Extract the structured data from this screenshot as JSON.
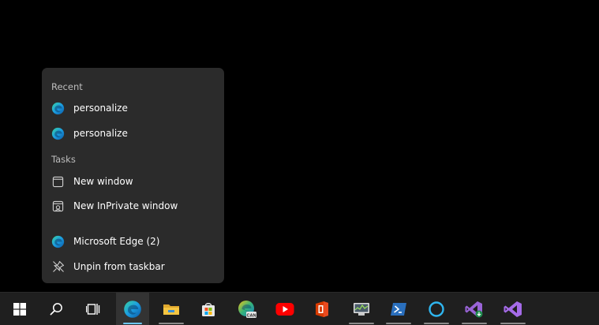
{
  "jumplist": {
    "recent_header": "Recent",
    "recent_items": [
      {
        "label": "personalize",
        "icon": "edge-icon"
      },
      {
        "label": "personalize",
        "icon": "edge-icon"
      }
    ],
    "tasks_header": "Tasks",
    "task_items": [
      {
        "label": "New window",
        "icon": "window-icon"
      },
      {
        "label": "New InPrivate window",
        "icon": "inprivate-window-icon"
      }
    ],
    "app_item": {
      "label": "Microsoft Edge (2)",
      "icon": "edge-icon"
    },
    "unpin_item": {
      "label": "Unpin from taskbar",
      "icon": "unpin-icon"
    }
  },
  "taskbar": {
    "buttons": [
      {
        "name": "start",
        "icon": "windows-logo-icon"
      },
      {
        "name": "search",
        "icon": "search-icon"
      },
      {
        "name": "task-view",
        "icon": "task-view-icon"
      },
      {
        "name": "edge",
        "icon": "edge-icon",
        "active": true
      },
      {
        "name": "file-explorer",
        "icon": "folder-icon",
        "running": true
      },
      {
        "name": "microsoft-store",
        "icon": "store-icon"
      },
      {
        "name": "edge-canary",
        "icon": "edge-canary-icon",
        "badge": "CAN"
      },
      {
        "name": "youtube",
        "icon": "youtube-icon"
      },
      {
        "name": "office",
        "icon": "office-icon"
      },
      {
        "name": "performance-monitor",
        "icon": "performance-monitor-icon",
        "running": true
      },
      {
        "name": "powershell",
        "icon": "powershell-icon",
        "running": true
      },
      {
        "name": "cortana",
        "icon": "cortana-icon",
        "running": true
      },
      {
        "name": "visual-studio-installer",
        "icon": "vs-installer-icon",
        "running": true
      },
      {
        "name": "visual-studio",
        "icon": "visual-studio-icon",
        "running": true
      }
    ]
  },
  "colors": {
    "menu_bg": "#2b2b2b",
    "taskbar_bg": "#1f1f1f",
    "accent": "#6cc6f5"
  }
}
